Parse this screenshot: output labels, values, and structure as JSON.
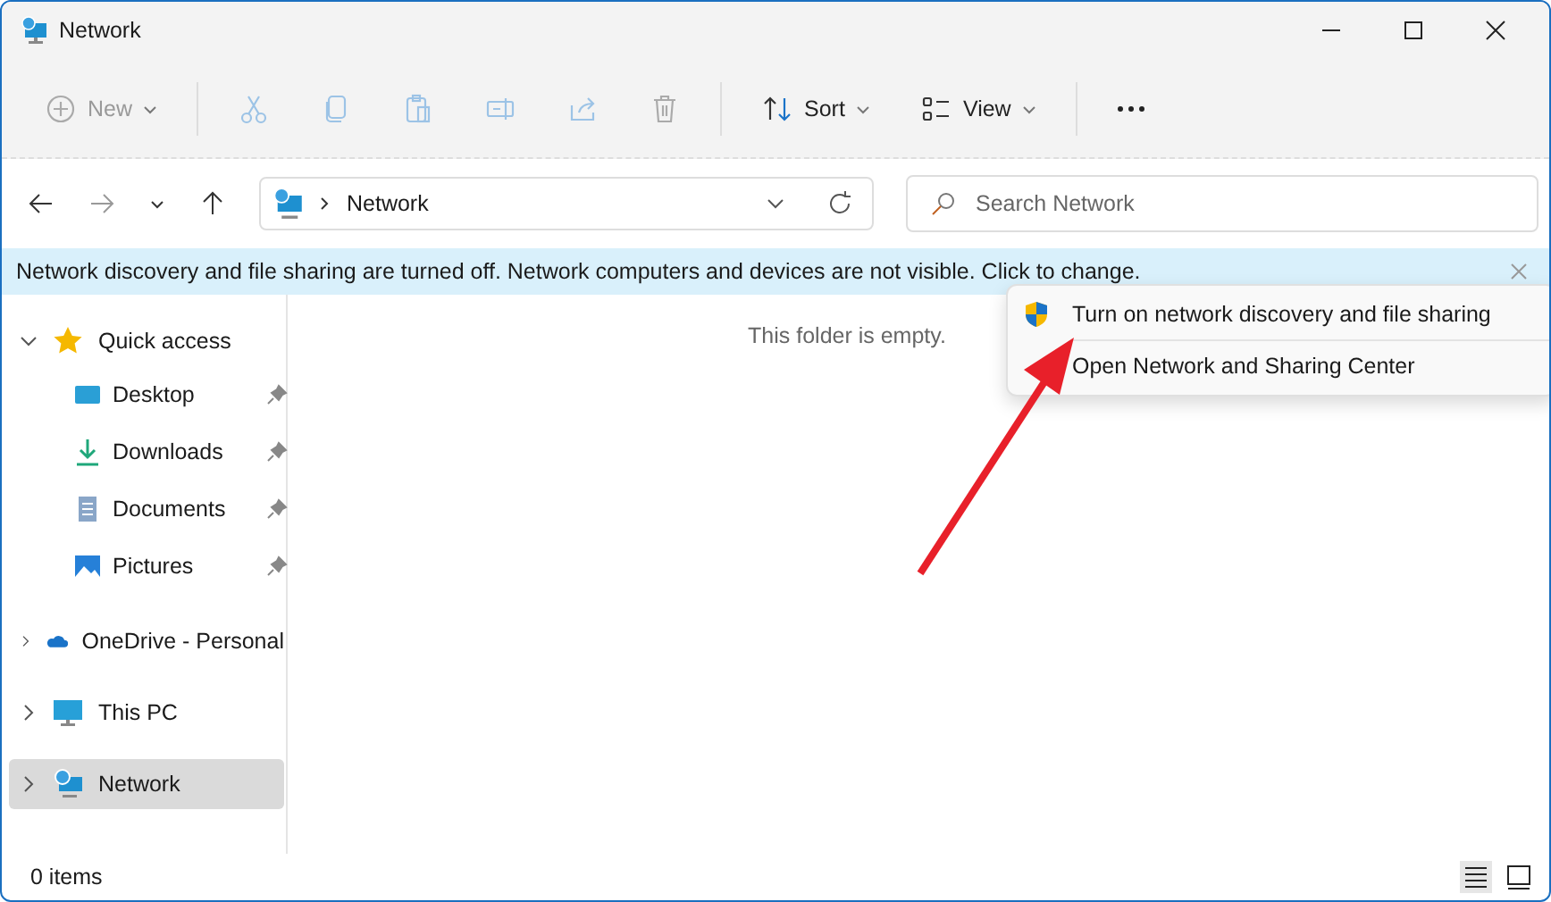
{
  "window": {
    "title": "Network"
  },
  "toolbar": [
    {
      "kind": "new",
      "label": "New",
      "disabled": true
    },
    {
      "kind": "cut",
      "disabled": true
    },
    {
      "kind": "copy",
      "disabled": true
    },
    {
      "kind": "paste",
      "disabled": true
    },
    {
      "kind": "rename",
      "disabled": true
    },
    {
      "kind": "share",
      "disabled": true
    },
    {
      "kind": "delete",
      "disabled": true
    },
    {
      "kind": "sort",
      "label": "Sort",
      "disabled": false
    },
    {
      "kind": "view",
      "label": "View",
      "disabled": false
    },
    {
      "kind": "more"
    }
  ],
  "address": {
    "path": "Network"
  },
  "search": {
    "placeholder": "Search Network"
  },
  "info_bar": {
    "text": "Network discovery and file sharing are turned off. Network computers and devices are not visible. Click to change."
  },
  "sidebar": {
    "items": [
      {
        "label": "Quick access",
        "kind": "star",
        "expanded": true,
        "selected": false,
        "children": [
          {
            "label": "Desktop",
            "kind": "desktop",
            "pinned": true
          },
          {
            "label": "Downloads",
            "kind": "download",
            "pinned": true
          },
          {
            "label": "Documents",
            "kind": "document",
            "pinned": true
          },
          {
            "label": "Pictures",
            "kind": "pictures",
            "pinned": true
          }
        ]
      },
      {
        "label": "OneDrive - Personal",
        "kind": "cloud",
        "expanded": false,
        "selected": false
      },
      {
        "label": "This PC",
        "kind": "pc",
        "expanded": false,
        "selected": false
      },
      {
        "label": "Network",
        "kind": "network",
        "expanded": false,
        "selected": true
      }
    ]
  },
  "content": {
    "empty_text": "This folder is empty."
  },
  "context_menu": [
    {
      "label": "Turn on network discovery and file sharing",
      "shield": true
    },
    {
      "label": "Open Network and Sharing Center",
      "shield": false
    }
  ],
  "status_bar": {
    "count": "0 items"
  }
}
